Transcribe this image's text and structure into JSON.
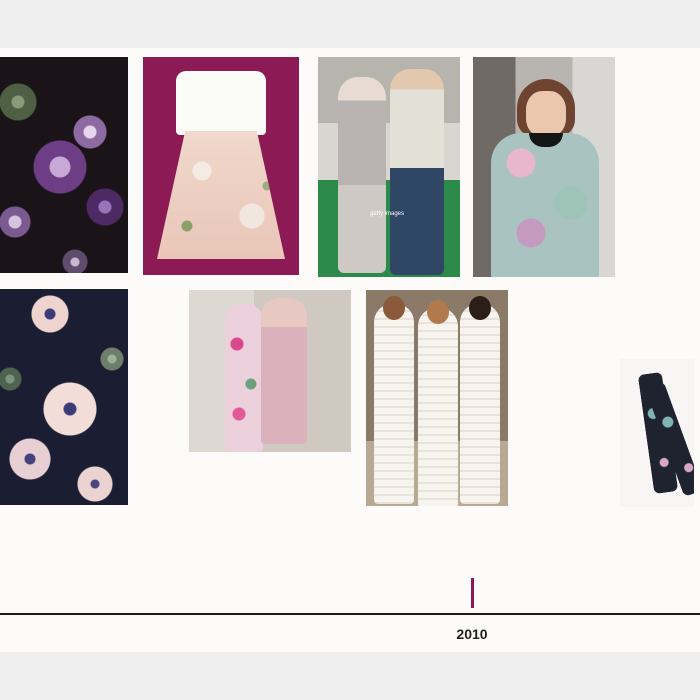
{
  "timeline": {
    "year": "2010",
    "accent_color": "#8c1a55"
  },
  "images": [
    {
      "name": "purple-floral-print"
    },
    {
      "name": "white-floral-dress"
    },
    {
      "name": "street-style-couple"
    },
    {
      "name": "model-floral-top"
    },
    {
      "name": "navy-floral-print"
    },
    {
      "name": "two-women-dresses"
    },
    {
      "name": "three-women-white-lace"
    },
    {
      "name": "floral-scarf"
    }
  ],
  "watermark": {
    "text": "getty images"
  }
}
